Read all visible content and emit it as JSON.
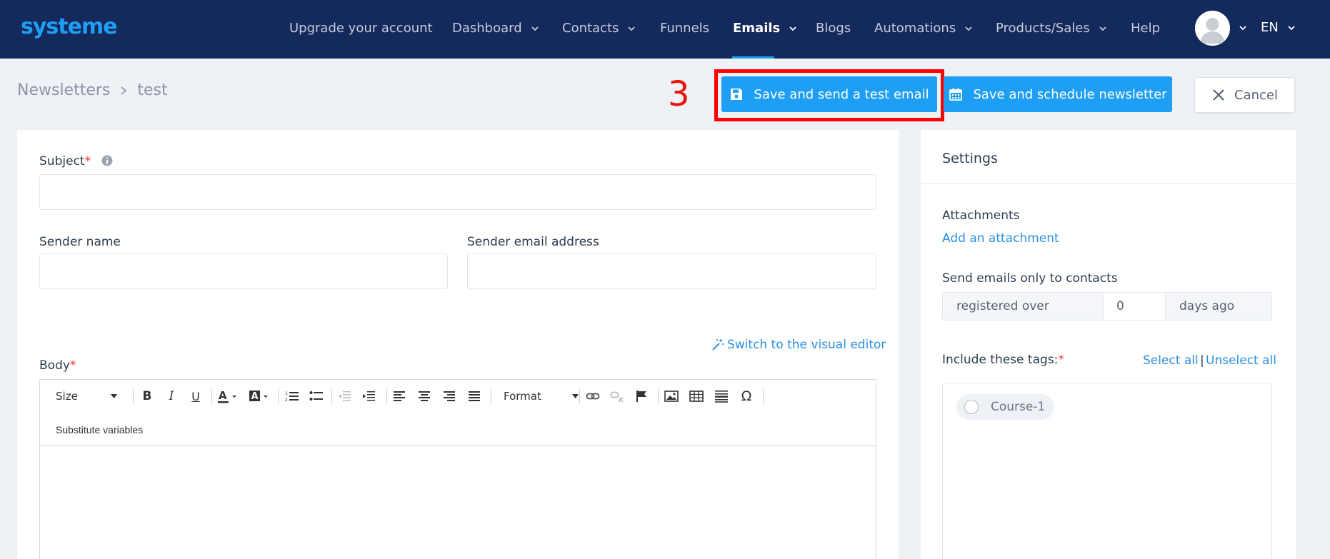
{
  "brand": {
    "logo_text": "systeme",
    "accent": "#1e9ef5",
    "nav_bg": "#14295c"
  },
  "nav": {
    "items": [
      {
        "label": "Upgrade your account",
        "dropdown": false
      },
      {
        "label": "Dashboard",
        "dropdown": true
      },
      {
        "label": "Contacts",
        "dropdown": true
      },
      {
        "label": "Funnels",
        "dropdown": false
      },
      {
        "label": "Emails",
        "dropdown": true,
        "active": true
      },
      {
        "label": "Blogs",
        "dropdown": false
      },
      {
        "label": "Automations",
        "dropdown": true
      },
      {
        "label": "Products/Sales",
        "dropdown": true
      },
      {
        "label": "Help",
        "dropdown": false
      }
    ],
    "language": "EN"
  },
  "breadcrumb": {
    "parent": "Newsletters",
    "current": "test"
  },
  "annotation": {
    "step_number": "3",
    "highlight_color": "#ff0000"
  },
  "actions": {
    "save_test": "Save and send a test email",
    "save_schedule": "Save and schedule newsletter",
    "cancel": "Cancel"
  },
  "form": {
    "subject_label": "Subject",
    "subject_value": "",
    "sender_name_label": "Sender name",
    "sender_name_value": "",
    "sender_email_label": "Sender email address",
    "sender_email_value": "",
    "switch_editor_link": "Switch to the visual editor",
    "body_label": "Body",
    "required_mark": "*"
  },
  "editor_toolbar": {
    "size_label": "Size",
    "format_label": "Format",
    "substitute_variables": "Substitute variables",
    "omega": "Ω"
  },
  "settings": {
    "title": "Settings",
    "attachments_label": "Attachments",
    "add_attachment": "Add an attachment",
    "send_only_label": "Send emails only to contacts",
    "registered_over": "registered over",
    "days_value": "0",
    "days_ago": "days ago",
    "include_tags_label": "Include these tags:",
    "select_all": "Select all",
    "separator": "|",
    "unselect_all": "Unselect all",
    "tags": [
      "Course-1"
    ]
  }
}
